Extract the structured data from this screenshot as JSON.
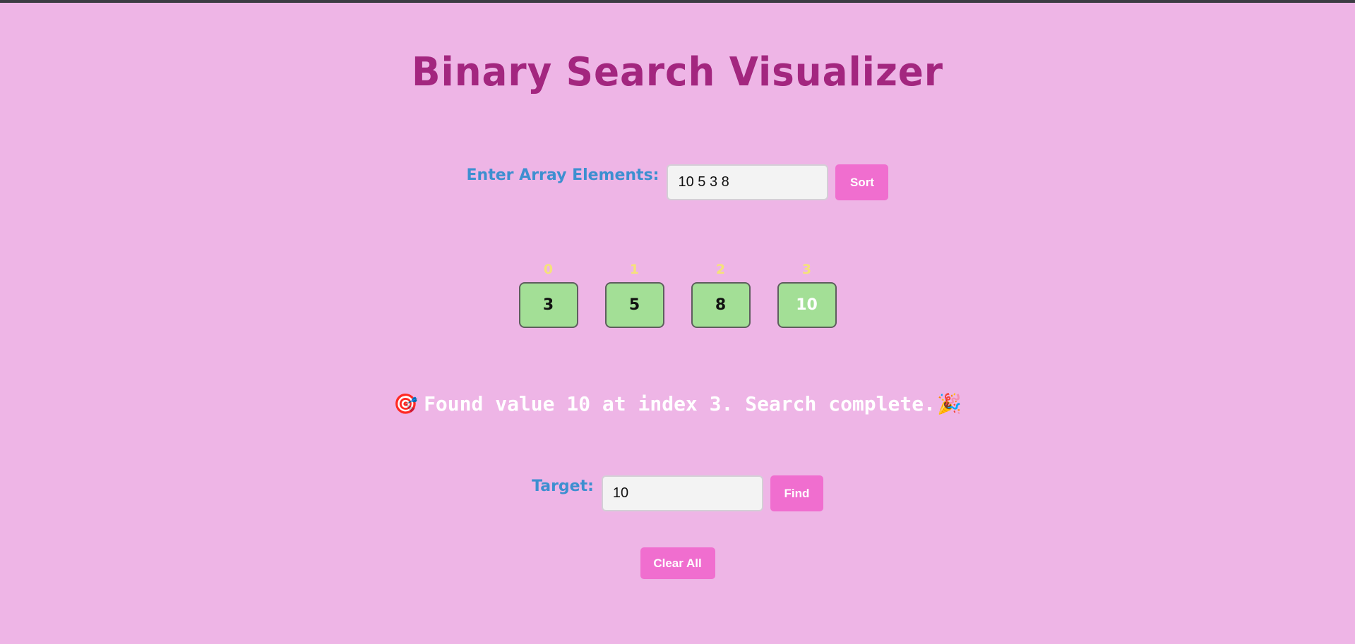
{
  "app": {
    "title": "Binary Search Visualizer"
  },
  "array_input": {
    "label": "Enter Array Elements:",
    "value": "10 5 3 8",
    "sort_label": "Sort"
  },
  "array": {
    "cells": [
      {
        "index": "0",
        "value": "3",
        "found": false
      },
      {
        "index": "1",
        "value": "5",
        "found": false
      },
      {
        "index": "2",
        "value": "8",
        "found": false
      },
      {
        "index": "3",
        "value": "10",
        "found": true
      }
    ]
  },
  "status": {
    "icon_start": "🎯",
    "message": "Found value 10 at index 3. Search complete.",
    "icon_end": "🎉"
  },
  "target_input": {
    "label": "Target:",
    "value": "10",
    "find_label": "Find"
  },
  "clear_all_label": "Clear All",
  "colors": {
    "background": "#eeb5e6",
    "title": "#a3267f",
    "label": "#3d8fd0",
    "button": "#f06ecf",
    "cell": "#a3df96",
    "index": "#f5e27a"
  }
}
